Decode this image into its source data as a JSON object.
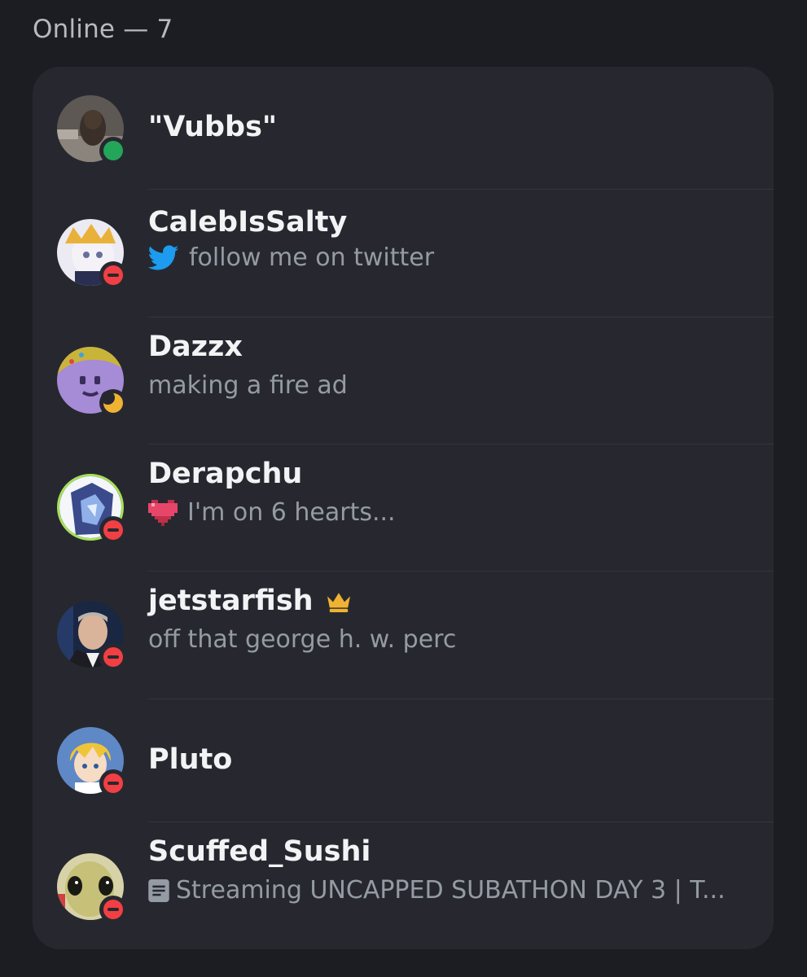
{
  "section": {
    "title": "Online — 7"
  },
  "members": [
    {
      "name": "\"Vubbs\"",
      "status": "online",
      "activity": ""
    },
    {
      "name": "CalebIsSalty",
      "status": "dnd",
      "activity": "follow me on twitter",
      "activity_icon": "twitter-bird-icon"
    },
    {
      "name": "Dazzx",
      "status": "idle",
      "activity": "making a fire ad"
    },
    {
      "name": "Derapchu",
      "status": "dnd",
      "activity": "I'm on 6 hearts...",
      "activity_icon": "pixel-heart-icon"
    },
    {
      "name": "jetstarfish",
      "status": "dnd",
      "activity": "off that george h. w. perc",
      "badge": "crown-icon"
    },
    {
      "name": "Pluto",
      "status": "dnd",
      "activity": ""
    },
    {
      "name": "Scuffed_Sushi",
      "status": "dnd",
      "activity": "Streaming UNCAPPED SUBATHON DAY 3 | T...",
      "activity_icon": "document-icon"
    }
  ],
  "colors": {
    "online": "#23a55a",
    "dnd": "#f23f43",
    "idle": "#f0b232",
    "twitter": "#1d9bf0",
    "crown": "#f0b232"
  }
}
